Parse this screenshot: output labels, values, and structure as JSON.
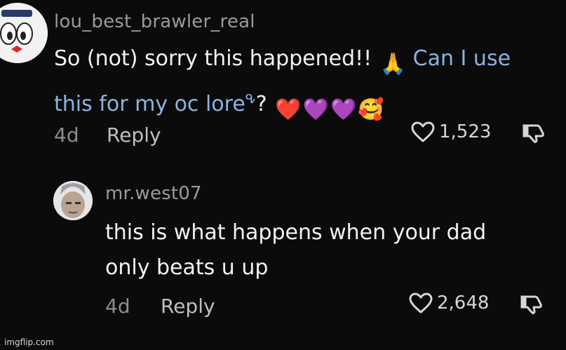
{
  "comments": [
    {
      "username": "lou_best_brawler_real",
      "text_plain_1": "So (not) sorry this happened!!",
      "emoji_1": "🙏",
      "link_text_line1": "Can I use",
      "link_text_line2": "this for my oc lore",
      "link_suffix": "?",
      "emojis_after": [
        "❤️",
        "💜",
        "💜",
        "🥰"
      ],
      "age": "4d",
      "reply_label": "Reply",
      "likes": "1,523"
    },
    {
      "username": "mr.west07",
      "text_line1": "this is what happens when your dad",
      "text_line2": "only beats u up",
      "age": "4d",
      "reply_label": "Reply",
      "likes": "2,648"
    }
  ],
  "watermark": "imgflip.com",
  "colors": {
    "background": "#0b0b0c",
    "link": "#8db3de",
    "muted": "#8d8d8d"
  }
}
